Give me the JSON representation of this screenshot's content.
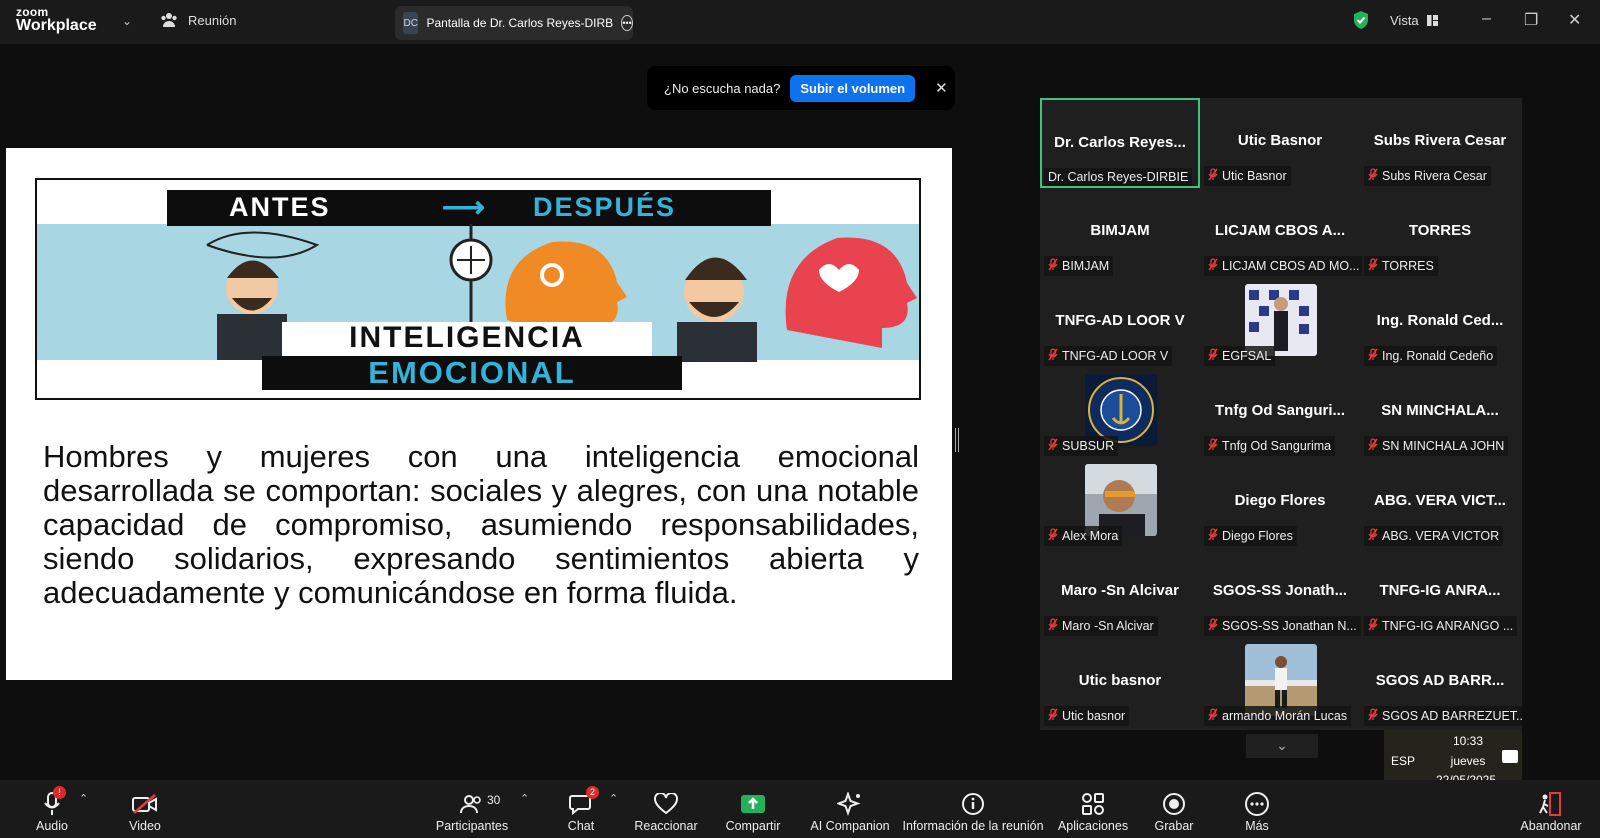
{
  "app": {
    "logo_top": "zoom",
    "logo_bottom": "Workplace",
    "meeting_label": "Reunión"
  },
  "share_tab": {
    "initials": "DC",
    "title": "Pantalla de Dr. Carlos Reyes-DIRB"
  },
  "header_right": {
    "view_label": "Vista"
  },
  "banner": {
    "text": "¿No escucha nada?",
    "button": "Subir el volumen"
  },
  "slide": {
    "image_top_left": "ANTES",
    "image_top_right": "DESPUÉS",
    "image_title_1": "INTELIGENCIA",
    "image_title_2": "EMOCIONAL",
    "body": "Hombres y mujeres con una inteligencia emocional desarrollada se comportan: sociales y alegres, con una notable capacidad de compromiso, asumiendo responsabilidades, siendo solidarios, expresando sentimientos abierta y adecuadamente y comunicándose en forma fluida."
  },
  "participants": [
    {
      "name": "Dr. Carlos Reyes...",
      "label": "Dr. Carlos Reyes-DIRBIE",
      "muted": false,
      "active": true
    },
    {
      "name": "Utic Basnor",
      "label": "Utic Basnor",
      "muted": true
    },
    {
      "name": "Subs Rivera Cesar",
      "label": "Subs Rivera Cesar",
      "muted": true
    },
    {
      "name": "BIMJAM",
      "label": "BIMJAM",
      "muted": true
    },
    {
      "name": "LICJAM CBOS A...",
      "label": "LICJAM CBOS AD MO...",
      "muted": true
    },
    {
      "name": "TORRES",
      "label": "TORRES",
      "muted": true
    },
    {
      "name": "TNFG-AD LOOR V",
      "label": "TNFG-AD LOOR V",
      "muted": true
    },
    {
      "name": "",
      "label": "EGFSAL",
      "muted": true,
      "photo": "photo-banner"
    },
    {
      "name": "Ing. Ronald Ced...",
      "label": "Ing. Ronald Cedeño",
      "muted": true
    },
    {
      "name": "",
      "label": "SUBSUR",
      "muted": true,
      "photo": "photo-emblem"
    },
    {
      "name": "Tnfg Od Sanguri...",
      "label": "Tnfg Od Sangurima",
      "muted": true
    },
    {
      "name": "SN MINCHALA...",
      "label": "SN MINCHALA JOHN",
      "muted": true
    },
    {
      "name": "",
      "label": "Alex Mora",
      "muted": true,
      "photo": "photo-selfie"
    },
    {
      "name": "Diego Flores",
      "label": "Diego Flores",
      "muted": true
    },
    {
      "name": "ABG. VERA VICT...",
      "label": "ABG. VERA VICTOR",
      "muted": true
    },
    {
      "name": "Maro -Sn Alcivar",
      "label": "Maro -Sn Alcivar",
      "muted": true
    },
    {
      "name": "SGOS-SS Jonath...",
      "label": "SGOS-SS Jonathan N...",
      "muted": true
    },
    {
      "name": "TNFG-IG ANRA...",
      "label": "TNFG-IG ANRANGO ...",
      "muted": true
    },
    {
      "name": "Utic basnor",
      "label": "Utic basnor",
      "muted": true
    },
    {
      "name": "",
      "label": "armando Morán Lucas",
      "muted": true,
      "photo": "photo-field"
    },
    {
      "name": "SGOS AD BARR...",
      "label": "SGOS AD BARREZUET...",
      "muted": true
    }
  ],
  "clock": {
    "lang": "ESP",
    "time": "10:33",
    "day": "jueves",
    "date": "22/05/2025"
  },
  "toolbar": {
    "audio": "Audio",
    "audio_badge": "!",
    "video": "Video",
    "participants": "Participantes",
    "participants_count": "30",
    "chat": "Chat",
    "chat_badge": "2",
    "react": "Reaccionar",
    "share": "Compartir",
    "ai": "AI Companion",
    "info": "Información de la reunión",
    "apps": "Aplicaciones",
    "record": "Grabar",
    "more": "Más",
    "leave": "Abandonar"
  },
  "colors": {
    "accent_blue": "#0e72ed",
    "share_green": "#23b25a",
    "active_border": "#3ec27d",
    "mute_red": "#e23d3d"
  }
}
